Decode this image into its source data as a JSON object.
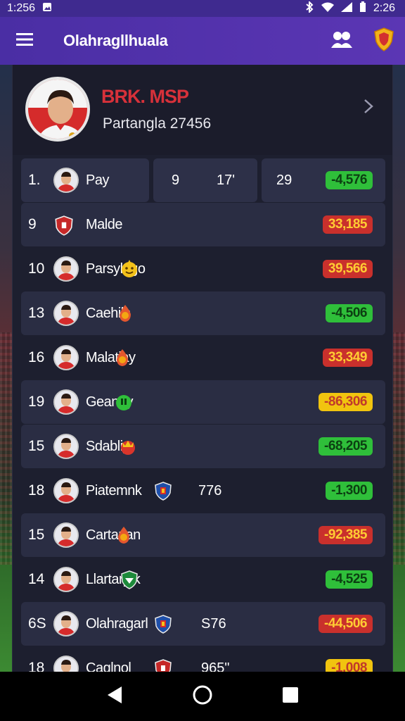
{
  "status_bar": {
    "time_left": "1:256",
    "time_right": "2:26"
  },
  "app_bar": {
    "title": "Olahragllhuala"
  },
  "profile": {
    "name": "BRK. MSP",
    "subtitle": "Partangla 27456"
  },
  "first_row": {
    "rank": "1.",
    "name": "Pay",
    "col_a": "9",
    "col_b": "17'",
    "col_c": "29",
    "score": "-4,576",
    "score_color": "green"
  },
  "rows": [
    {
      "rank": "9",
      "name": "Malde",
      "extra": "",
      "score": "33,185",
      "score_color": "red",
      "badge": "shield-red-icon",
      "light": true
    },
    {
      "rank": "10",
      "name": "Parsylngo",
      "extra": "",
      "score": "39,566",
      "score_color": "red",
      "badge": "smiley-badge-icon",
      "light": false
    },
    {
      "rank": "13",
      "name": "Caehils",
      "extra": "",
      "score": "-4,506",
      "score_color": "green",
      "badge": "flame-badge-icon",
      "light": true
    },
    {
      "rank": "16",
      "name": "Malatiay",
      "extra": "",
      "score": "33,349",
      "score_color": "red",
      "badge": "flame-badge-icon",
      "light": false
    },
    {
      "rank": "19",
      "name": "Geanay",
      "extra": "",
      "score": "-86,306",
      "score_color": "yellow",
      "badge": "green-badge-icon",
      "light": true
    },
    {
      "rank": "15",
      "name": "Sdabliy",
      "extra": "",
      "score": "-68,205",
      "score_color": "green",
      "badge": "crown-badge-icon",
      "light": true
    },
    {
      "rank": "18",
      "name": "Piatemnk",
      "extra": "776",
      "score": "-1,300",
      "score_color": "green",
      "badge": "crest-blue-icon",
      "light": false
    },
    {
      "rank": "15",
      "name": "Cartarian",
      "extra": "",
      "score": "-92,385",
      "score_color": "red",
      "badge": "flame-badge-icon",
      "light": true
    },
    {
      "rank": "14",
      "name": "Llartary ĸ",
      "extra": "",
      "score": "-4,525",
      "score_color": "green",
      "badge": "crest-green-icon",
      "light": false
    },
    {
      "rank": "6S",
      "name": "Olahragarl",
      "extra": "S76",
      "score": "-44,506",
      "score_color": "red",
      "badge": "crest-blue-icon",
      "light": true
    },
    {
      "rank": "18",
      "name": "Caqlnol",
      "extra": "965\"",
      "score": "-1,008",
      "score_color": "yellow",
      "badge": "shield-red-icon",
      "light": false
    }
  ],
  "colors": {
    "accent": "#4a2ea4",
    "green": "#2fbf3a",
    "red": "#c9302c",
    "yellow": "#f1c40f"
  }
}
